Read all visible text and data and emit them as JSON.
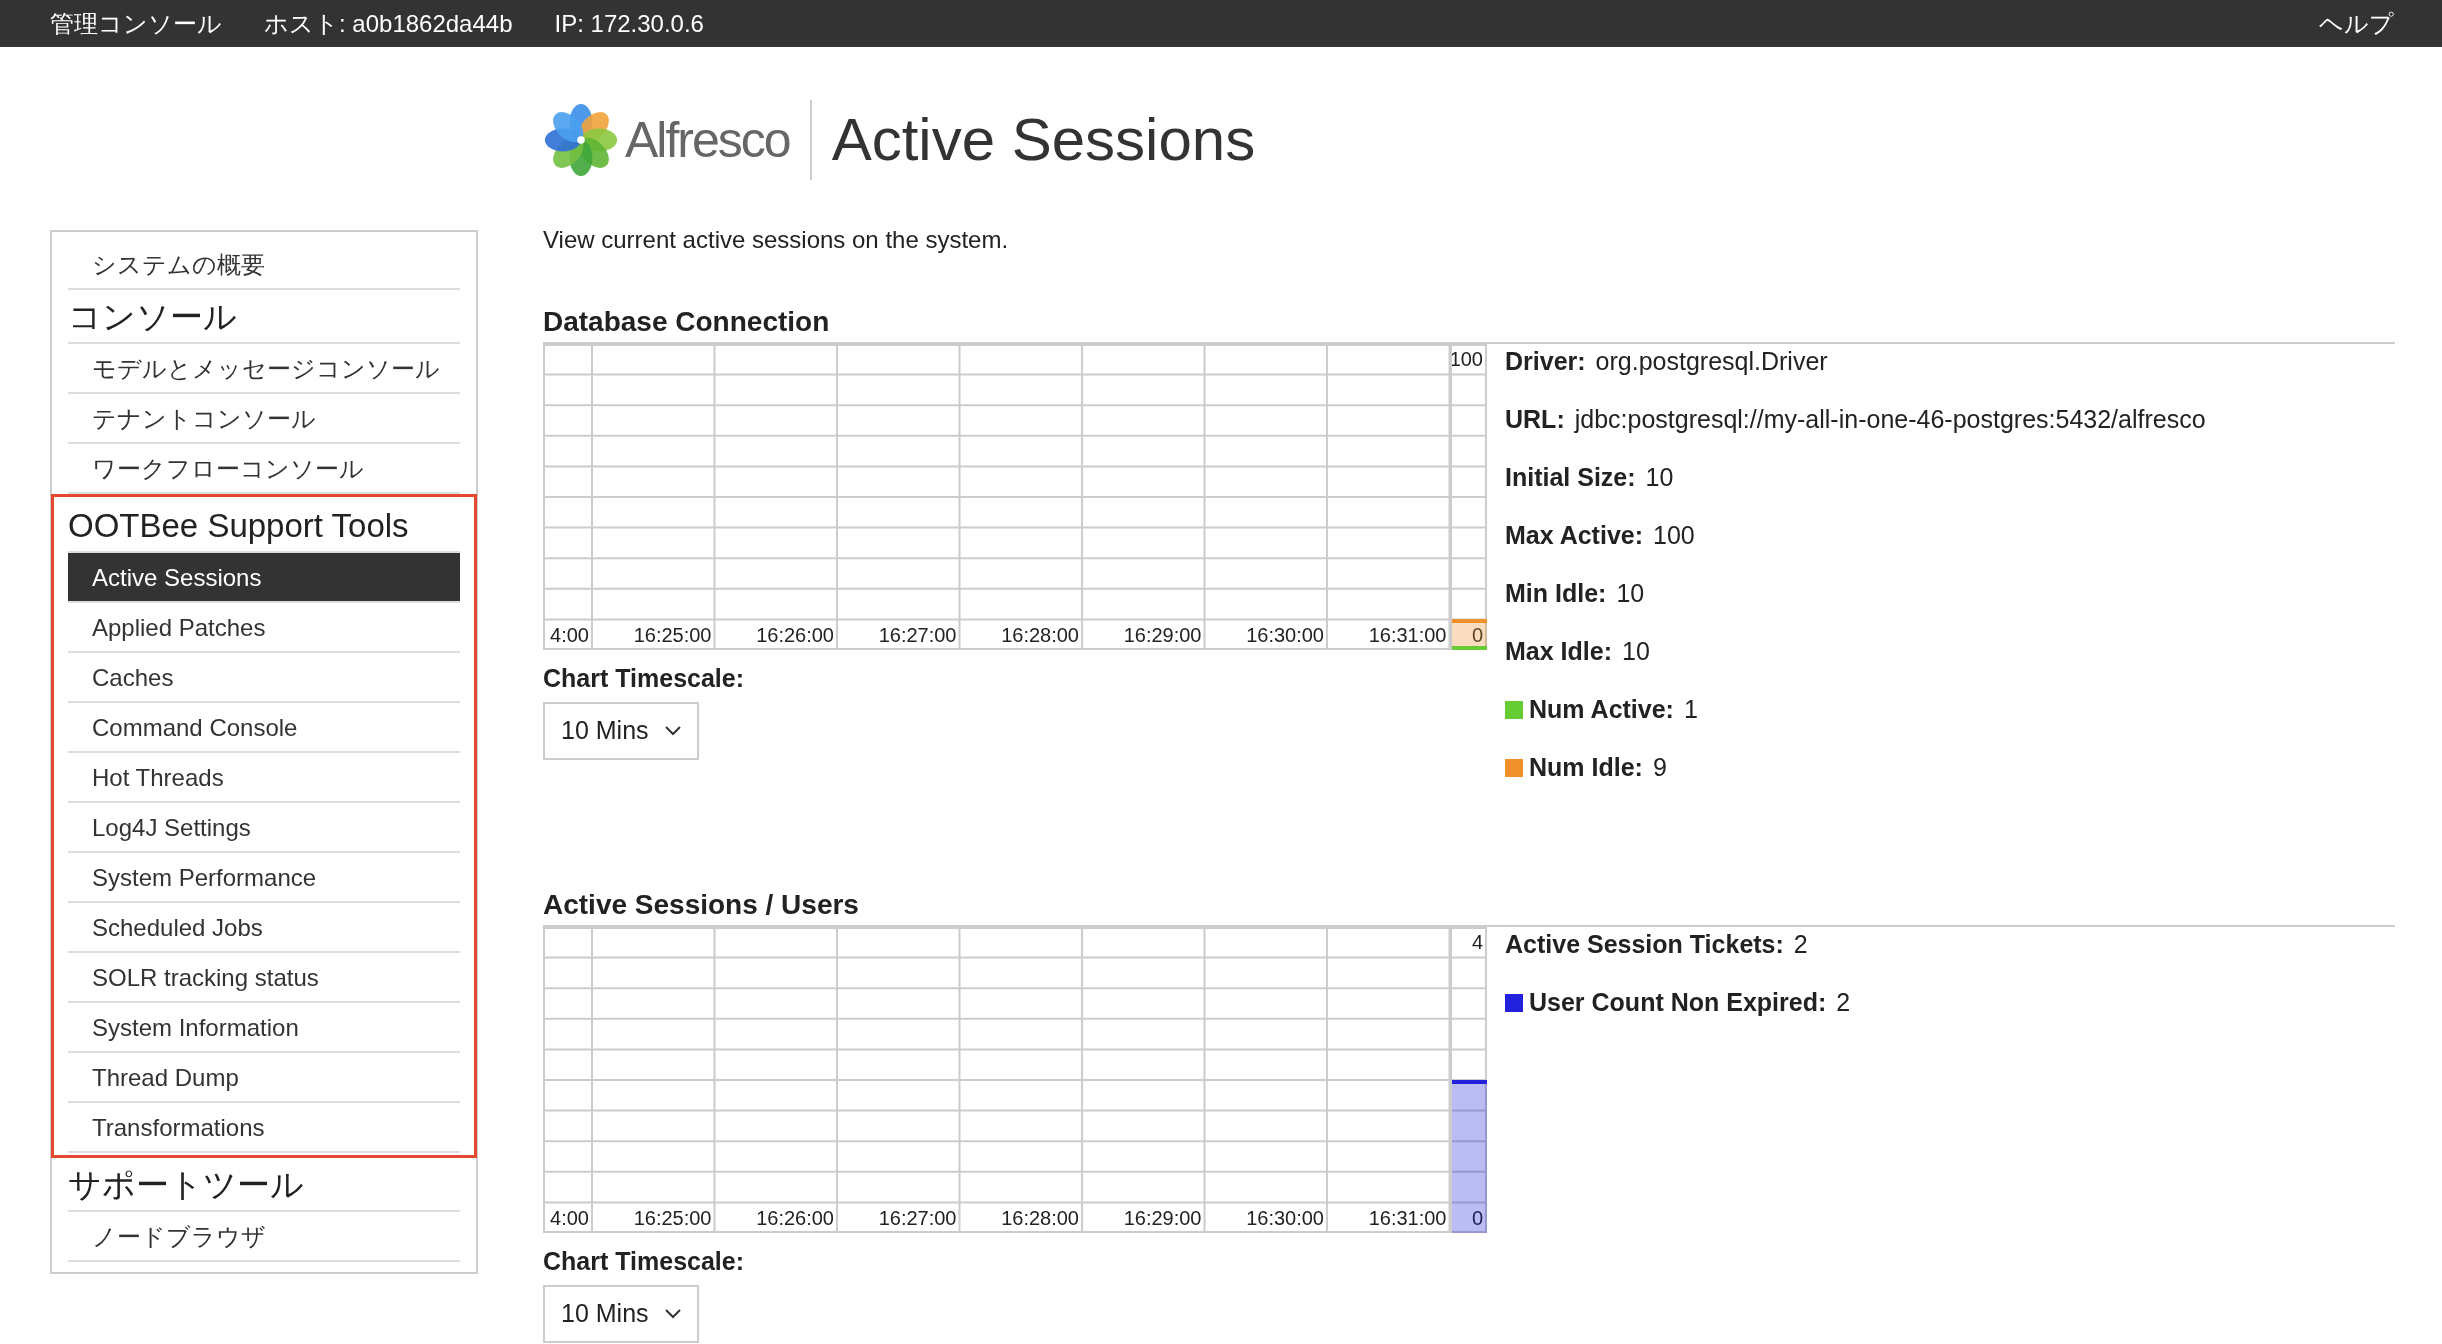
{
  "top_bar": {
    "title": "管理コンソール",
    "host": "ホスト: a0b1862da44b",
    "ip": "IP: 172.30.0.6",
    "help": "ヘルプ"
  },
  "header": {
    "logo_text": "Alfresco",
    "title": "Active Sessions"
  },
  "sidebar": {
    "items": [
      {
        "label": "システムの概要",
        "selected": false
      }
    ],
    "sections": [
      {
        "title": "コンソール",
        "highlighted": false,
        "items": [
          {
            "label": "モデルとメッセージコンソール",
            "selected": false
          },
          {
            "label": "テナントコンソール",
            "selected": false
          },
          {
            "label": "ワークフローコンソール",
            "selected": false
          }
        ]
      },
      {
        "title": "OOTBee Support Tools",
        "highlighted": true,
        "items": [
          {
            "label": "Active Sessions",
            "selected": true
          },
          {
            "label": "Applied Patches",
            "selected": false
          },
          {
            "label": "Caches",
            "selected": false
          },
          {
            "label": "Command Console",
            "selected": false
          },
          {
            "label": "Hot Threads",
            "selected": false
          },
          {
            "label": "Log4J Settings",
            "selected": false
          },
          {
            "label": "System Performance",
            "selected": false
          },
          {
            "label": "Scheduled Jobs",
            "selected": false
          },
          {
            "label": "SOLR tracking status",
            "selected": false
          },
          {
            "label": "System Information",
            "selected": false
          },
          {
            "label": "Thread Dump",
            "selected": false
          },
          {
            "label": "Transformations",
            "selected": false
          }
        ]
      },
      {
        "title": "サポートツール",
        "highlighted": false,
        "items": [
          {
            "label": "ノードブラウザ",
            "selected": false
          }
        ]
      }
    ]
  },
  "description": "View current active sessions on the system.",
  "sections": [
    {
      "title": "Database Connection",
      "chart": {
        "time_labels": [
          "4:00",
          "16:25:00",
          "16:26:00",
          "16:27:00",
          "16:28:00",
          "16:29:00",
          "16:30:00",
          "16:31:00"
        ],
        "y_labels": [
          "100",
          "0"
        ],
        "areas": [
          {
            "level": 0.01
          },
          {
            "level": 0.1
          }
        ]
      },
      "timescale_label": "Chart Timescale:",
      "timescale_value": "10 Mins",
      "details": [
        {
          "kind": "field",
          "label": "Driver:",
          "value": "org.postgresql.Driver"
        },
        {
          "kind": "field",
          "label": "URL:",
          "value": "jdbc:postgresql://my-all-in-one-46-postgres:5432/alfresco"
        },
        {
          "kind": "field",
          "label": "Initial Size:",
          "value": "10"
        },
        {
          "kind": "field",
          "label": "Max Active:",
          "value": "100"
        },
        {
          "kind": "field",
          "label": "Min Idle:",
          "value": "10"
        },
        {
          "kind": "field",
          "label": "Max Idle:",
          "value": "10"
        },
        {
          "kind": "legend",
          "label": "Num Active:",
          "value": "1",
          "color": "#66cc33"
        },
        {
          "kind": "legend",
          "label": "Num Idle:",
          "value": "9",
          "color": "#f0902a"
        }
      ]
    },
    {
      "title": "Active Sessions / Users",
      "chart": {
        "time_labels": [
          "4:00",
          "16:25:00",
          "16:26:00",
          "16:27:00",
          "16:28:00",
          "16:29:00",
          "16:30:00",
          "16:31:00"
        ],
        "y_labels": [
          "4",
          "0"
        ],
        "areas": [
          {
            "level": 0.5
          }
        ]
      },
      "timescale_label": "Chart Timescale:",
      "timescale_value": "10 Mins",
      "details": [
        {
          "kind": "field",
          "label": "Active Session Tickets:",
          "value": "2"
        },
        {
          "kind": "legend",
          "label": "User Count Non Expired:",
          "value": "2",
          "color": "#2222dd"
        }
      ]
    }
  ]
}
